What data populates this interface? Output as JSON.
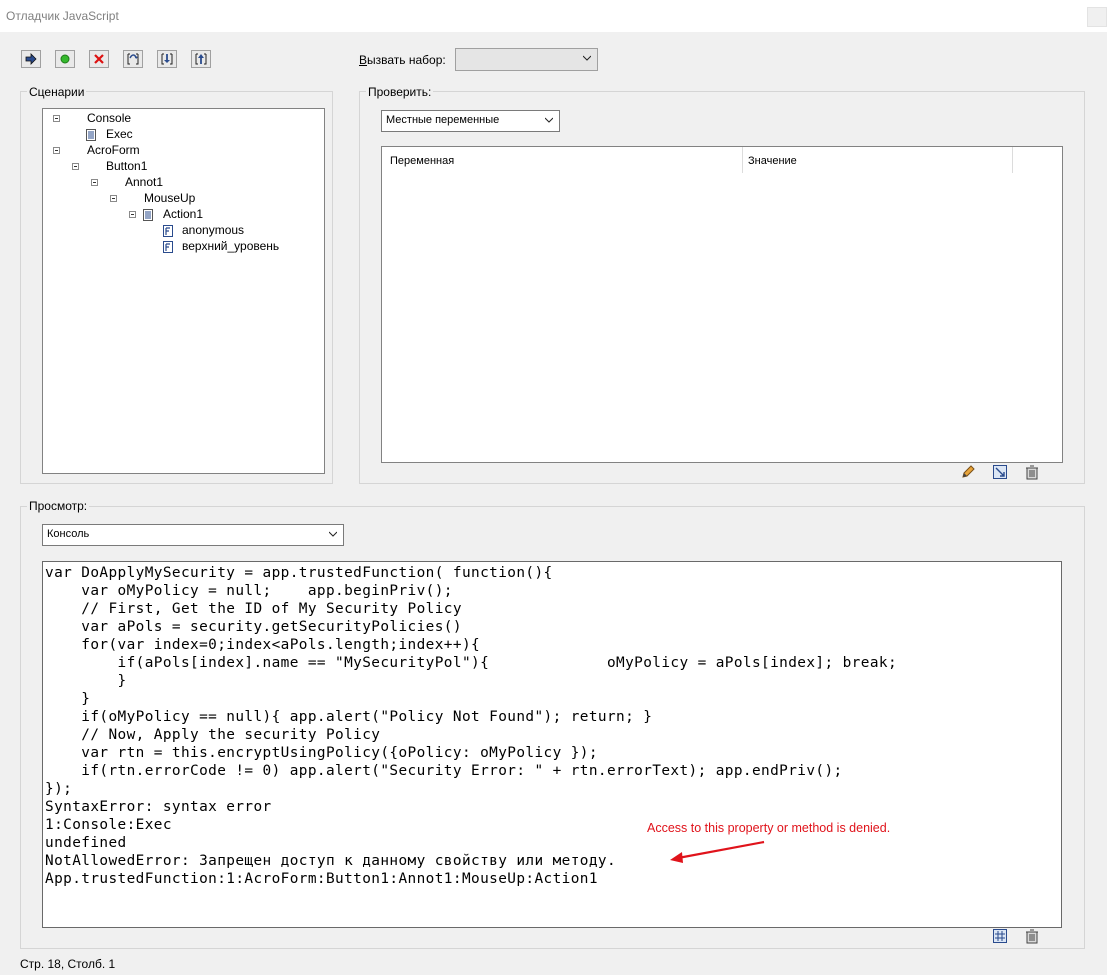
{
  "window": {
    "title": "Отладчик JavaScript"
  },
  "toolbar": {
    "buttons": [
      {
        "name": "resume",
        "icon": "resume-arrow-icon"
      },
      {
        "name": "stop",
        "icon": "green-dot-icon"
      },
      {
        "name": "clear",
        "icon": "red-x-icon"
      },
      {
        "name": "step-over",
        "icon": "step-over-icon"
      },
      {
        "name": "step-into",
        "icon": "step-into-icon"
      },
      {
        "name": "step-out",
        "icon": "step-out-icon"
      }
    ],
    "callstack_label": "Вызвать набор:",
    "callstack_value": ""
  },
  "scripts_panel": {
    "label": "Сценарии",
    "tree": [
      {
        "label": "Console",
        "expanded": true
      },
      {
        "label": "Exec"
      },
      {
        "label": "AcroForm",
        "expanded": true
      },
      {
        "label": "Button1",
        "expanded": true
      },
      {
        "label": "Annot1",
        "expanded": true
      },
      {
        "label": "MouseUp",
        "expanded": true
      },
      {
        "label": "Action1",
        "expanded": true
      },
      {
        "label": "anonymous"
      },
      {
        "label": "верхний_уровень"
      }
    ]
  },
  "inspect_panel": {
    "label": "Проверить:",
    "dropdown_value": "Местные переменные",
    "columns": [
      "Переменная",
      "Значение"
    ],
    "rows": []
  },
  "view_panel": {
    "label": "Просмотр:",
    "dropdown_value": "Консоль",
    "console_lines": [
      "var DoApplyMySecurity = app.trustedFunction( function(){",
      "    var oMyPolicy = null;    app.beginPriv();",
      "    // First, Get the ID of My Security Policy",
      "    var aPols = security.getSecurityPolicies()",
      "    for(var index=0;index<aPols.length;index++){",
      "        if(aPols[index].name == \"MySecurityPol\"){             oMyPolicy = aPols[index]; break;",
      "        }",
      "    }",
      "    if(oMyPolicy == null){ app.alert(\"Policy Not Found\"); return; }",
      "    // Now, Apply the security Policy",
      "    var rtn = this.encryptUsingPolicy({oPolicy: oMyPolicy });",
      "    if(rtn.errorCode != 0) app.alert(\"Security Error: \" + rtn.errorText); app.endPriv();",
      "});",
      "SyntaxError: syntax error",
      "1:Console:Exec",
      "undefined",
      "NotAllowedError: Запрещен доступ к данному свойству или методу.",
      "App.trustedFunction:1:AcroForm:Button1:Annot1:MouseUp:Action1"
    ]
  },
  "annotation": {
    "text": "Access to this property or method is denied.",
    "color": "#e0131b"
  },
  "status": {
    "text": "Стр. 18, Столб. 1"
  }
}
